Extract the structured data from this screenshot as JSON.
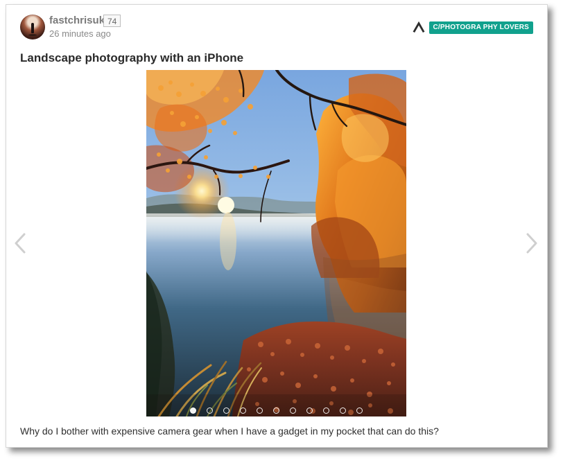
{
  "post": {
    "author": {
      "username": "fastchrisuk",
      "score": "74",
      "timestamp": "26 minutes ago"
    },
    "community": {
      "label": "C/PHOTOGRA PHY LOVERS",
      "icon": "community-chevron-icon",
      "accent": "#11a18d"
    },
    "title": "Landscape photography with an iPhone",
    "image": {
      "alt": "Autumn river scene at sunrise with orange trees, reflections and a low bright sun"
    },
    "caption": "Why do I bother with expensive camera gear when I have a gadget in my pocket that can do this?",
    "carousel": {
      "current": 1,
      "total": 11,
      "prev_icon": "chevron-left-icon",
      "next_icon": "chevron-right-icon"
    }
  }
}
